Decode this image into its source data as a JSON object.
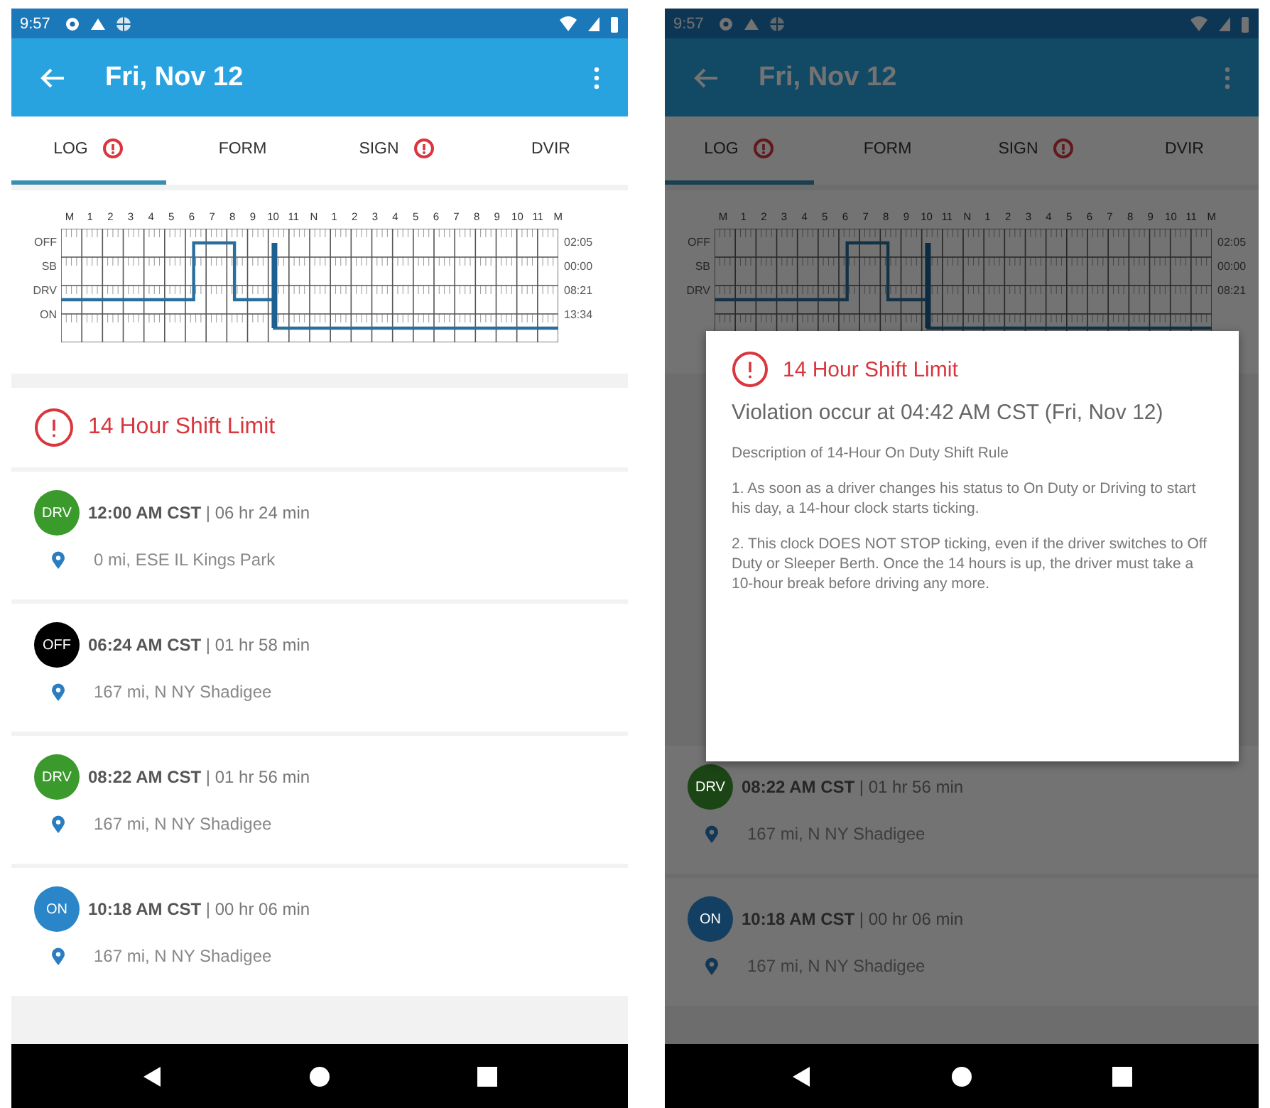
{
  "screens": [
    {
      "status_bar": {
        "time": "9:57"
      },
      "app_bar": {
        "title": "Fri, Nov 12"
      },
      "tabs": [
        {
          "label": "LOG",
          "selected": true,
          "alert": true
        },
        {
          "label": "FORM",
          "selected": false,
          "alert": false
        },
        {
          "label": "SIGN",
          "selected": false,
          "alert": true
        },
        {
          "label": "DVIR",
          "selected": false,
          "alert": false
        }
      ],
      "graph": {
        "hours": [
          "M",
          "1",
          "2",
          "3",
          "4",
          "5",
          "6",
          "7",
          "8",
          "9",
          "10",
          "11",
          "N",
          "1",
          "2",
          "3",
          "4",
          "5",
          "6",
          "7",
          "8",
          "9",
          "10",
          "11",
          "M"
        ],
        "rows": [
          {
            "label": "OFF",
            "total": "02:05"
          },
          {
            "label": "SB",
            "total": "00:00"
          },
          {
            "label": "DRV",
            "total": "08:21"
          },
          {
            "label": "ON",
            "total": "13:34"
          }
        ]
      },
      "violation": {
        "title": "14 Hour Shift Limit"
      },
      "entries": [
        {
          "status": "DRV",
          "color": "#3b9a2c",
          "line": "**12:00 AM CST** | 06 hr 24 min",
          "location": "0 mi, ESE IL Kings Park"
        },
        {
          "status": "OFF",
          "color": "#000000",
          "line": "**06:24 AM CST** | 01 hr 58 min",
          "location": "167 mi, N NY Shadigee"
        },
        {
          "status": "DRV",
          "color": "#3b9a2c",
          "line": "**08:22 AM CST** | 01 hr 56 min",
          "location": "167 mi, N NY Shadigee"
        },
        {
          "status": "ON",
          "color": "#2a86c8",
          "line": "**10:18 AM CST** | 00 hr 06 min",
          "location": "167 mi, N NY Shadigee"
        }
      ]
    },
    {
      "status_bar": {
        "time": "9:57"
      },
      "app_bar": {
        "title": "Fri, Nov 12"
      },
      "tabs": [
        {
          "label": "LOG",
          "selected": true,
          "alert": true
        },
        {
          "label": "FORM",
          "selected": false,
          "alert": false
        },
        {
          "label": "SIGN",
          "selected": false,
          "alert": true
        },
        {
          "label": "DVIR",
          "selected": false,
          "alert": false
        }
      ],
      "graph": {
        "hours": [
          "M",
          "1",
          "2",
          "3",
          "4",
          "5",
          "6",
          "7",
          "8",
          "9",
          "10",
          "11",
          "N",
          "1",
          "2",
          "3",
          "4",
          "5",
          "6",
          "7",
          "8",
          "9",
          "10",
          "11",
          "M"
        ],
        "rows": [
          {
            "label": "OFF",
            "total": "02:05"
          },
          {
            "label": "SB",
            "total": "00:00"
          },
          {
            "label": "DRV",
            "total": "08:21"
          }
        ]
      },
      "entries": [
        {
          "status": "DRV",
          "color": "#1b4514",
          "line": "**08:22 AM CST** | 01 hr 56 min",
          "location": "167 mi, N NY Shadigee"
        },
        {
          "status": "ON",
          "color": "#134062",
          "line": "**10:18 AM CST** | 00 hr 06 min",
          "location": "167 mi, N NY Shadigee"
        }
      ],
      "dialog": {
        "title": "14 Hour Shift Limit",
        "subtitle": "Violation occur at 04:42 AM CST (Fri, Nov 12)",
        "paragraphs": [
          "Description of 14-Hour On Duty Shift Rule",
          "1. As soon as a driver changes his status to On Duty or Driving to start his day, a 14-hour clock starts ticking.",
          "2. This clock DOES NOT STOP ticking, even if the driver switches to Off Duty or Sleeper Berth. Once the 14 hours is up, the driver must take a 10-hour break before driving any more."
        ]
      }
    }
  ]
}
